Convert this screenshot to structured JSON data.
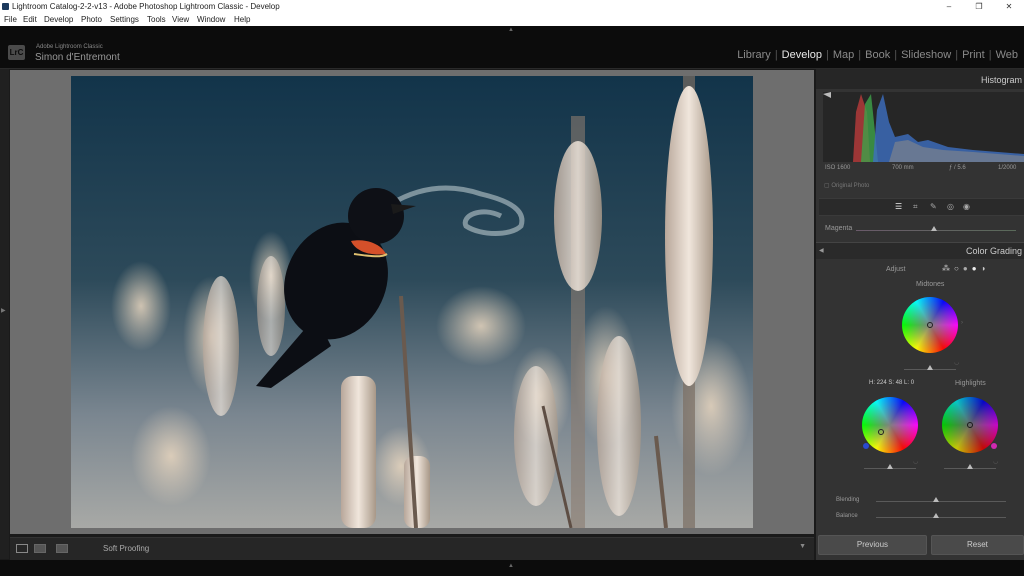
{
  "window": {
    "title": "Lightroom Catalog-2-2-v13 - Adobe Photoshop Lightroom Classic - Develop",
    "controls": [
      "–",
      "❐",
      "✕"
    ]
  },
  "menu": [
    "File",
    "Edit",
    "Develop",
    "Photo",
    "Settings",
    "Tools",
    "View",
    "Window",
    "Help"
  ],
  "identity": {
    "logo": "LrC",
    "app_name": "Adobe Lightroom Classic",
    "user": "Simon d'Entremont"
  },
  "modules": [
    "Library",
    "Develop",
    "Map",
    "Book",
    "Slideshow",
    "Print",
    "Web"
  ],
  "active_module": "Develop",
  "toolbar": {
    "soft_proofing": "Soft Proofing"
  },
  "histogram": {
    "title": "Histogram",
    "iso": "ISO 1600",
    "focal": "700 mm",
    "aperture": "ƒ / 5.6",
    "shutter": "1/2000",
    "original_photo": "Original Photo"
  },
  "tint": {
    "label": "Magenta"
  },
  "color_grading": {
    "title": "Color Grading",
    "adjust_label": "Adjust",
    "midtones_label": "Midtones",
    "shadows_readout": "H: 224 S: 48 L: 0",
    "highlights_label": "Highlights",
    "blending_label": "Blending",
    "balance_label": "Balance"
  },
  "buttons": {
    "previous": "Previous",
    "reset": "Reset"
  }
}
